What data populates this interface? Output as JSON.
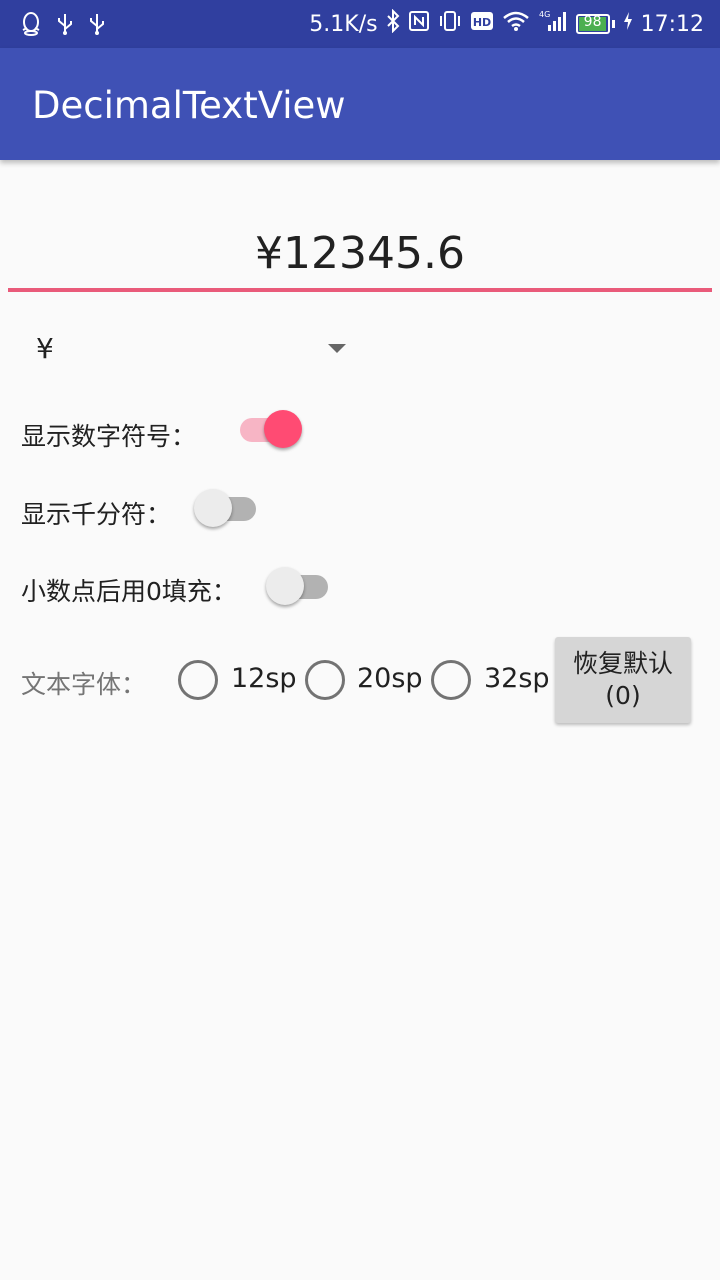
{
  "status_bar": {
    "net_speed": "5.1K/s",
    "battery": "98",
    "battery_level": 0.98,
    "time": "17:12",
    "left_icons": [
      "qq-icon",
      "usb-icon",
      "usb-icon"
    ],
    "right_icons": [
      "bluetooth-icon",
      "nfc-icon",
      "vibrate-icon",
      "hd-icon",
      "wifi-icon",
      "signal-4g-icon",
      "charging-icon"
    ]
  },
  "app_bar": {
    "title": "DecimalTextView"
  },
  "decimal_view": {
    "text": "¥12345.6"
  },
  "symbol_spinner": {
    "selected": "¥"
  },
  "options": {
    "show_symbol": {
      "label": "显示数字符号：",
      "checked": true
    },
    "show_thousands": {
      "label": "显示千分符：",
      "checked": false
    },
    "zero_fill": {
      "label": "小数点后用0填充：",
      "checked": false
    }
  },
  "font_size": {
    "label": "文本字体：",
    "options": [
      "12sp",
      "20sp",
      "32sp"
    ],
    "selected": null
  },
  "reset_button": {
    "label": "恢复默认(0)"
  },
  "colors": {
    "status_bar": "#303f9f",
    "app_bar": "#3f51b5",
    "accent": "#ff4b73",
    "background": "#fafafa"
  }
}
